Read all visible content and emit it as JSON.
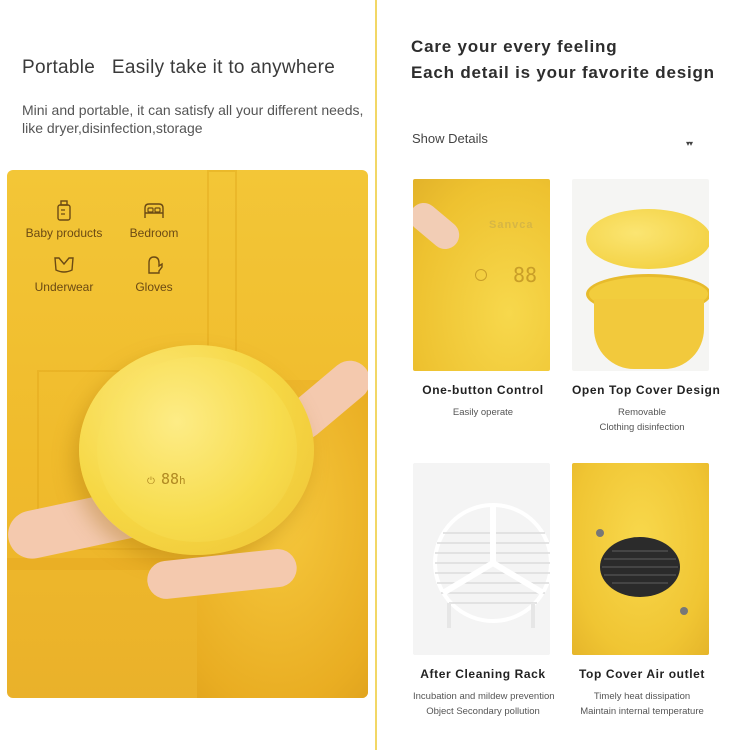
{
  "left": {
    "title": "Portable   Easily take it to anywhere",
    "description": "Mini and portable, it can satisfy all your different needs, like dryer,disinfection,storage",
    "usages": [
      {
        "label": "Baby products",
        "icon": "baby-bottle-icon"
      },
      {
        "label": "Bedroom",
        "icon": "bed-icon"
      },
      {
        "label": "Underwear",
        "icon": "underwear-icon"
      },
      {
        "label": "Gloves",
        "icon": "glove-icon"
      }
    ],
    "device_display": "88",
    "device_unit": "h"
  },
  "right": {
    "title_line1": "Care your every feeling",
    "title_line2": "Each detail is your favorite design",
    "show_details": "Show Details",
    "show_arrow": "▾▾",
    "brand": "Sanvca",
    "features": [
      {
        "name": "One-button Control",
        "desc1": "Easily operate",
        "desc2": ""
      },
      {
        "name": "Open Top Cover Design",
        "desc1": "Removable",
        "desc2": "Clothing disinfection"
      },
      {
        "name": "After Cleaning Rack",
        "desc1": "Incubation and mildew prevention",
        "desc2": "Object Secondary pollution"
      },
      {
        "name": "Top Cover Air outlet",
        "desc1": "Timely heat dissipation",
        "desc2": "Maintain internal temperature"
      }
    ]
  },
  "colors": {
    "accent_yellow": "#f5d443",
    "divider": "#f2d766",
    "wall": "#f0bb2c"
  }
}
